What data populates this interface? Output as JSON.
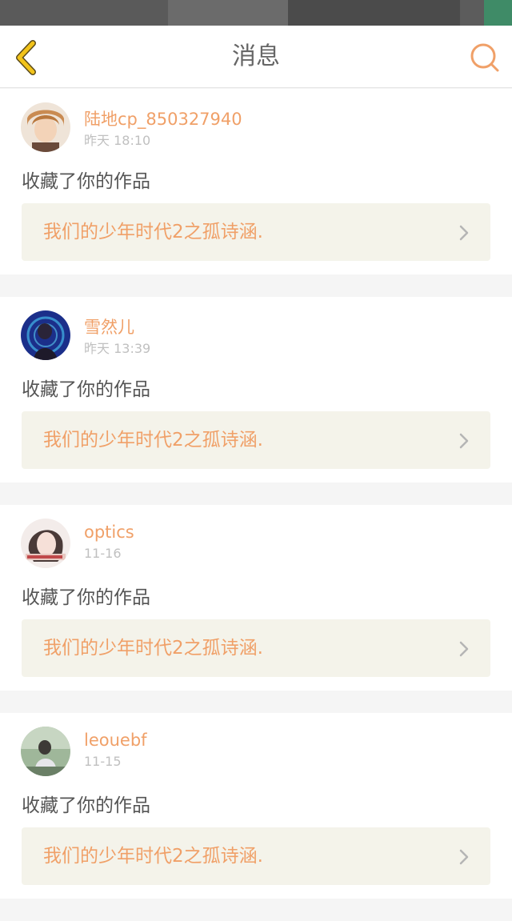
{
  "header": {
    "title": "消息",
    "back_icon": "chevron-left-icon",
    "search_icon": "search-icon",
    "accent": "#f0a068",
    "back_color": "#f2c31a"
  },
  "notifications": [
    {
      "username": "陆地cp_850327940",
      "time": "昨天 18:10",
      "action": "收藏了你的作品",
      "work_title": "我们的少年时代2之孤诗涵."
    },
    {
      "username": "雪然儿",
      "time": "昨天 13:39",
      "action": "收藏了你的作品",
      "work_title": "我们的少年时代2之孤诗涵."
    },
    {
      "username": "optics",
      "time": "11-16",
      "action": "收藏了你的作品",
      "work_title": "我们的少年时代2之孤诗涵."
    },
    {
      "username": "leouebf",
      "time": "11-15",
      "action": "收藏了你的作品",
      "work_title": "我们的少年时代2之孤诗涵."
    }
  ]
}
